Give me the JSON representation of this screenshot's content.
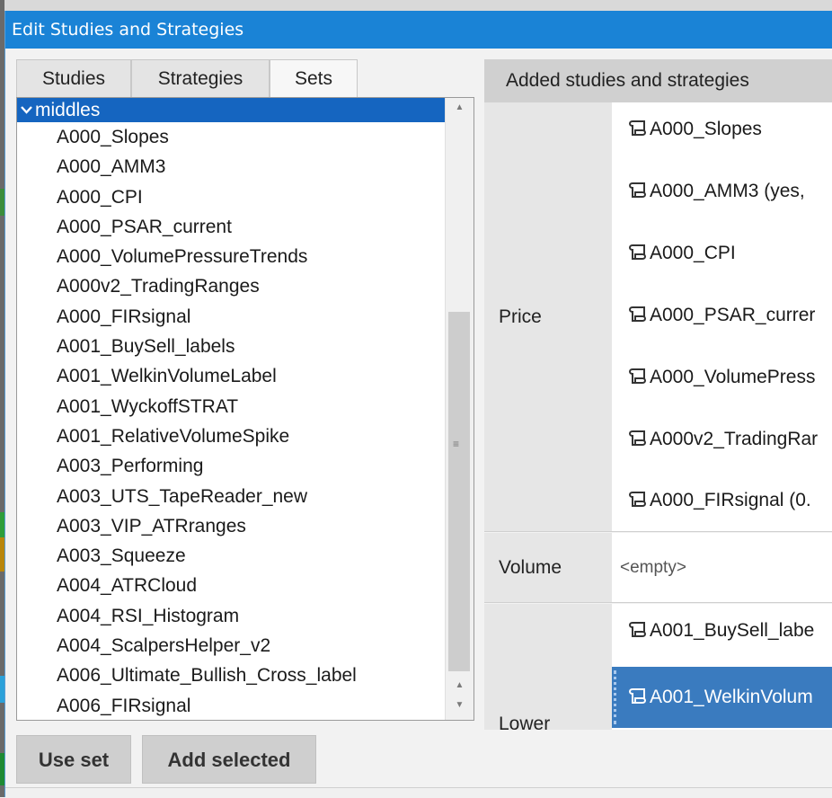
{
  "window": {
    "title": "Edit Studies and Strategies"
  },
  "left": {
    "tabs": [
      {
        "label": "Studies",
        "active": false
      },
      {
        "label": "Strategies",
        "active": false
      },
      {
        "label": "Sets",
        "active": true
      }
    ],
    "group": {
      "label": "middles",
      "icon": "chevron-down-icon"
    },
    "items": [
      "A000_Slopes",
      "A000_AMM3",
      "A000_CPI",
      "A000_PSAR_current",
      "A000_VolumePressureTrends",
      "A000v2_TradingRanges",
      "A000_FIRsignal",
      "A001_BuySell_labels",
      "A001_WelkinVolumeLabel",
      "A001_WyckoffSTRAT",
      "A001_RelativeVolumeSpike",
      "A003_Performing",
      "A003_UTS_TapeReader_new",
      "A003_VIP_ATRranges",
      "A003_Squeeze",
      "A004_ATRCloud",
      "A004_RSI_Histogram",
      "A004_ScalpersHelper_v2",
      "A006_Ultimate_Bullish_Cross_label",
      "A006_FIRsignal"
    ],
    "buttons": {
      "use_set": "Use set",
      "add_selected": "Add selected"
    }
  },
  "right": {
    "header": "Added studies and strategies",
    "price": {
      "label": "Price",
      "entries": [
        "A000_Slopes",
        "A000_AMM3 (yes,",
        "A000_CPI",
        "A000_PSAR_currer",
        "A000_VolumePress",
        "A000v2_TradingRar",
        "A000_FIRsignal (0."
      ]
    },
    "volume": {
      "label": "Volume",
      "empty": "<empty>"
    },
    "lower": {
      "label": "Lower",
      "entries": [
        "A001_BuySell_labe",
        "A001_WelkinVolum"
      ]
    }
  },
  "colors": {
    "titlebar": "#1a83d6",
    "selection": "#1565c0",
    "selected_entry": "#3a7bbf"
  }
}
